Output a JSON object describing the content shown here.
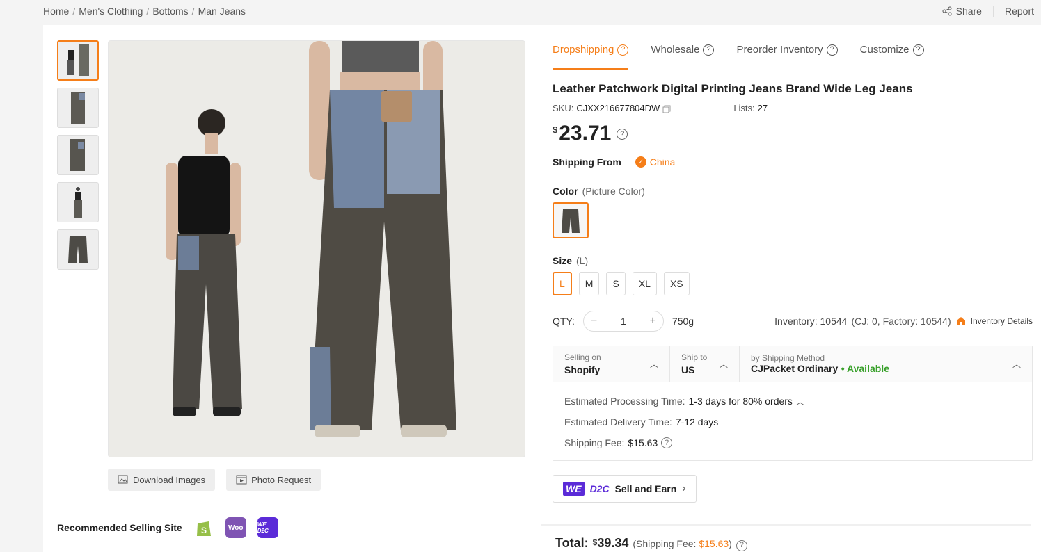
{
  "breadcrumb": [
    "Home",
    "Men's Clothing",
    "Bottoms",
    "Man Jeans"
  ],
  "top_actions": {
    "share": "Share",
    "report": "Report"
  },
  "gallery": {
    "thumbnails": [
      "thumb-1",
      "thumb-2",
      "thumb-3",
      "thumb-4",
      "thumb-5"
    ],
    "download_label": "Download Images",
    "photo_request_label": "Photo Request"
  },
  "recommended": {
    "label": "Recommended Selling Site",
    "sites": [
      {
        "name": "shopify-icon",
        "color": "#96bf48"
      },
      {
        "name": "woo-icon",
        "color": "#7f54b3",
        "text": "Woo"
      },
      {
        "name": "wed2c-icon",
        "color": "#5b2bd8",
        "text": "WE D2C"
      }
    ]
  },
  "tabs": [
    {
      "label": "Dropshipping",
      "active": true
    },
    {
      "label": "Wholesale"
    },
    {
      "label": "Preorder Inventory"
    },
    {
      "label": "Customize"
    }
  ],
  "product": {
    "title": "Leather Patchwork Digital Printing Jeans Brand Wide Leg Jeans",
    "sku_label": "SKU:",
    "sku": "CJXX216677804DW",
    "lists_label": "Lists:",
    "lists": "27",
    "currency": "$",
    "price": "23.71",
    "shipping_from_label": "Shipping From",
    "shipping_from": "China",
    "color_label": "Color",
    "color_value": "(Picture Color)",
    "size_label": "Size",
    "size_value": "(L)",
    "sizes": [
      "L",
      "M",
      "S",
      "XL",
      "XS"
    ],
    "qty_label": "QTY:",
    "qty": "1",
    "weight": "750g",
    "inventory_text": "Inventory: 10544",
    "inventory_detail": "(CJ: 0, Factory: 10544)",
    "inventory_link": "Inventory Details"
  },
  "shipping": {
    "selling_on_label": "Selling on",
    "selling_on": "Shopify",
    "ship_to_label": "Ship to",
    "ship_to": "US",
    "method_label": "by Shipping Method",
    "method": "CJPacket Ordinary",
    "availability": "• Available",
    "processing_label": "Estimated Processing Time:",
    "processing": "1-3 days for 80% orders",
    "delivery_label": "Estimated Delivery Time:",
    "delivery": "7-12 days",
    "fee_label": "Shipping Fee:",
    "fee": "$15.63"
  },
  "d2c": {
    "we": "WE",
    "d2c": "D2C",
    "label": "Sell and Earn"
  },
  "total": {
    "label": "Total:",
    "currency": "$",
    "amount": "39.34",
    "fee_prefix": "(Shipping Fee: ",
    "fee": "$15.63",
    "fee_suffix": ")"
  },
  "colors": {
    "accent": "#f57e19",
    "available": "#38a02a",
    "d2c": "#5b2bd8"
  }
}
